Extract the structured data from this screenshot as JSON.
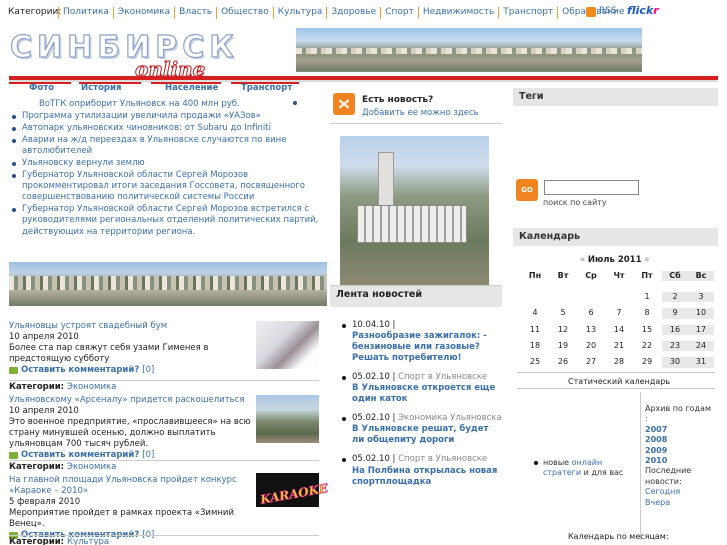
{
  "topbar": {
    "label": "Категории:",
    "categories": [
      "Политика",
      "Экономика",
      "Власть",
      "Общество",
      "Культура",
      "Здоровье",
      "Спорт",
      "Недвижимость",
      "Транспорт",
      "Образование"
    ],
    "rss": "RSS",
    "flickr_a": "flick",
    "flickr_b": "r"
  },
  "logo": {
    "line1": "СИНБИРСК",
    "line2": "online"
  },
  "nav": {
    "tabs": [
      "Фото",
      "История",
      "Население",
      "Транспорт"
    ]
  },
  "news_list": [
    "ВоТГК оприборит Ульяновск на 400 млн руб.",
    "Программа утилизации увеличила продажи «УАЗов»",
    "Автопарк ульяновских чиновников: от Subaru до Infiniti",
    "Аварии на ж/д переездах в Ульяновске случаются по вине автолюбителей",
    "Ульяновску вернули землю",
    "Губернатор Ульяновской области Сергей Морозов прокомментировал итоги заседания Госсовета, посвященного совершенствованию политической системы России",
    "Губернатор Ульяновской области Сергей Морозов встретился с руководителями региональных отделений политических партий, действующих на территории региона."
  ],
  "articles": [
    {
      "title": "Ульяновцы устроят свадебный бум",
      "date": "10 апреля 2010",
      "desc": "Более ста пар свяжут себя узами Гименея в предстоящую субботу",
      "comment": "Оставить комментарий?",
      "count": "[0]",
      "cat_label": "Категории:",
      "cat": "Экономика"
    },
    {
      "title": "Ульяновскому «Арсеналу» придется раскошелиться",
      "date": "10 апреля 2010",
      "desc": "Это военное предприятие, «прославившееся» на всю страну минувшей осенью, должно выплатить ульяновцам 700 тысяч рублей.",
      "comment": "Оставить комментарий?",
      "count": "[0]",
      "cat_label": "Категории:",
      "cat": "Экономика"
    },
    {
      "title": "На главной площади Ульяновска пройдет конкурс «Караоке – 2010»",
      "date": "5 февраля 2010",
      "desc": "Мероприятие пройдет в рамках проекта «Зимний Венец».",
      "comment": "Оставить комментарий?",
      "count": "[0]",
      "cat_label": "Категории:",
      "cat": "Культура"
    }
  ],
  "karaoke_text": "KARAOKE",
  "mid": {
    "est_title": "Есть новость?",
    "est_link": "Добавить ее можно здесь",
    "lenta_title": "Лента новостей",
    "feed": [
      {
        "date": "10.04.10 |",
        "cat": "",
        "headline": "Разнообразие зажигалок: - бензиновые или газовые? Решать потребителю!"
      },
      {
        "date": "05.02.10 |",
        "cat": "Спорт в Ульяновске",
        "headline": "В Ульяновске откроется еще один каток"
      },
      {
        "date": "05.02.10 |",
        "cat": "Экономика Ульяновска",
        "headline": "В Ульяновске решат, будет ли общепиту дороги"
      },
      {
        "date": "05.02.10 |",
        "cat": "Спорт в Ульяновске",
        "headline": "На Полбина открылась новая спортплощадка"
      }
    ]
  },
  "right": {
    "tags_title": "Теги",
    "go": "GO",
    "search_label": "поиск по сайту",
    "cal_title": "Календарь",
    "cal_prev": "«",
    "cal_month": "Июль 2011",
    "cal_next": "»",
    "weekdays": [
      "Пн",
      "Вт",
      "Ср",
      "Чт",
      "Пт",
      "Сб",
      "Вс"
    ],
    "weeks": [
      [
        "",
        "",
        "",
        "",
        "1",
        "2",
        "3"
      ],
      [
        "4",
        "5",
        "6",
        "7",
        "8",
        "9",
        "10"
      ],
      [
        "11",
        "12",
        "13",
        "14",
        "15",
        "16",
        "17"
      ],
      [
        "18",
        "19",
        "20",
        "21",
        "22",
        "23",
        "24"
      ],
      [
        "25",
        "26",
        "27",
        "28",
        "29",
        "30",
        "31"
      ]
    ],
    "static_cal": "Статический календарь",
    "bullet_pre": "новые ",
    "bullet_link": "онлайн стратеги",
    "bullet_post": " и для вас",
    "archive_label": "Архив по годам",
    "archive_colon": ":",
    "years": [
      "2007",
      "2008",
      "2009",
      "2010"
    ],
    "last_news": "Последние новости:",
    "today": "Сегодня",
    "yesterday": "Вчера",
    "cal_by_month": "Календарь по месяцам:"
  }
}
